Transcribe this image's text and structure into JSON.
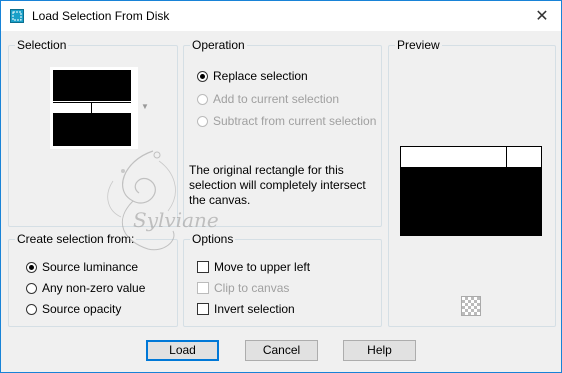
{
  "window": {
    "title": "Load Selection From Disk"
  },
  "selection": {
    "legend": "Selection"
  },
  "operation": {
    "legend": "Operation",
    "options": [
      {
        "label": "Replace selection",
        "selected": true,
        "enabled": true
      },
      {
        "label": "Add to current selection",
        "selected": false,
        "enabled": false
      },
      {
        "label": "Subtract from current selection",
        "selected": false,
        "enabled": false
      }
    ],
    "info": "The original rectangle for this selection will completely intersect the canvas."
  },
  "preview": {
    "legend": "Preview"
  },
  "create_from": {
    "legend": "Create selection from:",
    "options": [
      {
        "label": "Source luminance",
        "selected": true
      },
      {
        "label": "Any non-zero value",
        "selected": false
      },
      {
        "label": "Source opacity",
        "selected": false
      }
    ]
  },
  "options": {
    "legend": "Options",
    "items": [
      {
        "label": "Move to upper left",
        "checked": false,
        "enabled": true
      },
      {
        "label": "Clip to canvas",
        "checked": false,
        "enabled": false
      },
      {
        "label": "Invert selection",
        "checked": false,
        "enabled": true
      }
    ]
  },
  "buttons": {
    "load": "Load",
    "cancel": "Cancel",
    "help": "Help"
  },
  "watermark": {
    "text": "Sylviane"
  },
  "colors": {
    "accent": "#0078d7",
    "title_border": "#1883d7"
  }
}
